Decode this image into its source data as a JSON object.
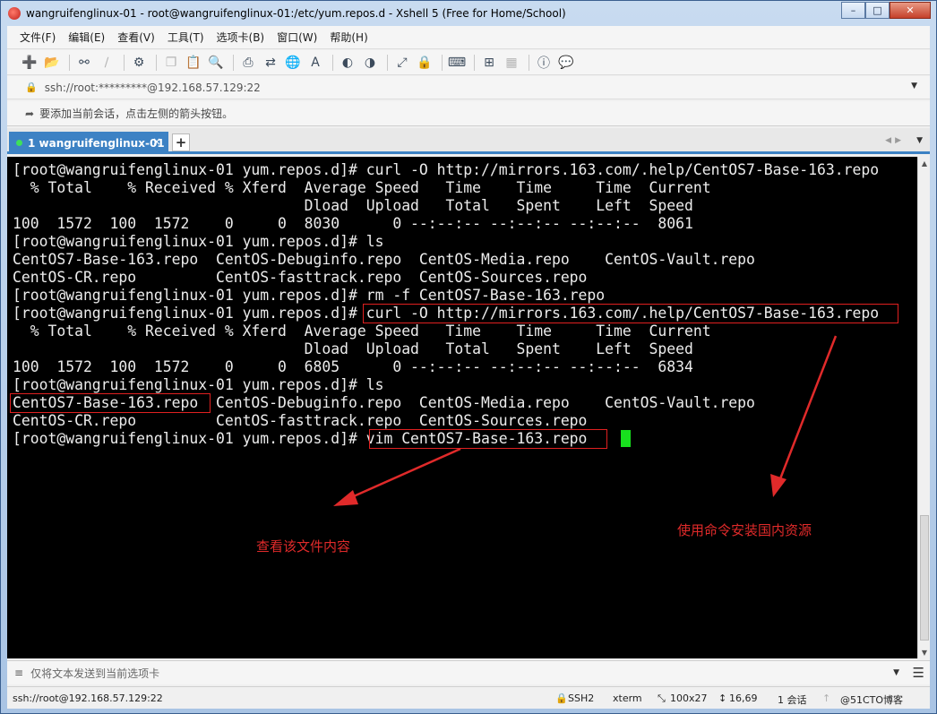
{
  "window": {
    "title": "wangruifenglinux-01 - root@wangruifenglinux-01:/etc/yum.repos.d - Xshell 5 (Free for Home/School)"
  },
  "menu": [
    "文件(F)",
    "编辑(E)",
    "查看(V)",
    "工具(T)",
    "选项卡(B)",
    "窗口(W)",
    "帮助(H)"
  ],
  "address": {
    "value": "ssh://root:*********@192.168.57.129:22"
  },
  "hint": {
    "text": "要添加当前会话，点击左侧的箭头按钮。"
  },
  "tab": {
    "label": "1 wangruifenglinux-01",
    "close": "×",
    "add": "+"
  },
  "terminal": {
    "lines": [
      "[root@wangruifenglinux-01 yum.repos.d]# curl -O http://mirrors.163.com/.help/CentOS7-Base-163.repo",
      "  % Total    % Received % Xferd  Average Speed   Time    Time     Time  Current",
      "                                 Dload  Upload   Total   Spent    Left  Speed",
      "100  1572  100  1572    0     0  8030      0 --:--:-- --:--:-- --:--:--  8061",
      "[root@wangruifenglinux-01 yum.repos.d]# ls",
      "CentOS7-Base-163.repo  CentOS-Debuginfo.repo  CentOS-Media.repo    CentOS-Vault.repo",
      "CentOS-CR.repo         CentOS-fasttrack.repo  CentOS-Sources.repo",
      "[root@wangruifenglinux-01 yum.repos.d]# rm -f CentOS7-Base-163.repo",
      "[root@wangruifenglinux-01 yum.repos.d]# curl -O http://mirrors.163.com/.help/CentOS7-Base-163.repo",
      "  % Total    % Received % Xferd  Average Speed   Time    Time     Time  Current",
      "                                 Dload  Upload   Total   Spent    Left  Speed",
      "100  1572  100  1572    0     0  6805      0 --:--:-- --:--:-- --:--:--  6834",
      "[root@wangruifenglinux-01 yum.repos.d]# ls",
      "CentOS7-Base-163.repo  CentOS-Debuginfo.repo  CentOS-Media.repo    CentOS-Vault.repo",
      "CentOS-CR.repo         CentOS-fasttrack.repo  CentOS-Sources.repo",
      "[root@wangruifenglinux-01 yum.repos.d]# vim CentOS7-Base-163.repo"
    ],
    "cursor_color": "#18e01e"
  },
  "annotations": {
    "view_file": "查看该文件内容",
    "install_source": "使用命令安装国内资源",
    "color": "#e02a2a"
  },
  "sendbar": {
    "placeholder": "仅将文本发送到当前选项卡"
  },
  "status": {
    "connection": "ssh://root@192.168.57.129:22",
    "protocol": "SSH2",
    "terminal_type": "xterm",
    "size": "100x27",
    "cursor_pos": "16,69",
    "sessions": "1 会话",
    "watermark": "@51CTO博客"
  },
  "colors": {
    "tab_active": "#3d82c4",
    "terminal_bg": "#000000",
    "terminal_fg": "#ececec"
  }
}
